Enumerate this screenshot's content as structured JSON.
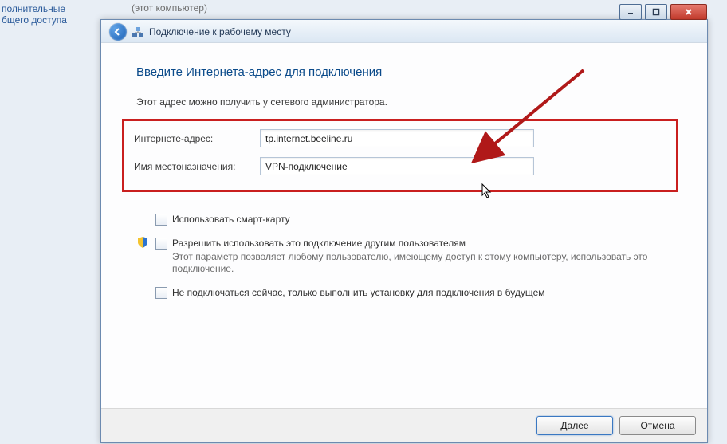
{
  "background": {
    "fragment1_line1": "полнительные",
    "fragment1_line2": "бщего доступа",
    "fragment2": "(этот компьютер)"
  },
  "window": {
    "title": "Подключение к рабочему месту",
    "heading": "Введите Интернета-адрес для подключения",
    "instruction": "Этот адрес можно получить у сетевого администратора.",
    "form": {
      "address_label": "Интернете-адрес:",
      "address_value": "tp.internet.beeline.ru",
      "destination_label": "Имя местоназначения:",
      "destination_value": "VPN-подключение"
    },
    "options": {
      "smartcard": "Использовать смарт-карту",
      "allow_others": "Разрешить использовать это подключение другим пользователям",
      "allow_others_desc": "Этот параметр позволяет любому пользователю, имеющему доступ к этому компьютеру, использовать это подключение.",
      "dont_connect": "Не подключаться сейчас, только выполнить установку для подключения в будущем"
    },
    "buttons": {
      "next": "Далее",
      "cancel": "Отмена"
    }
  }
}
